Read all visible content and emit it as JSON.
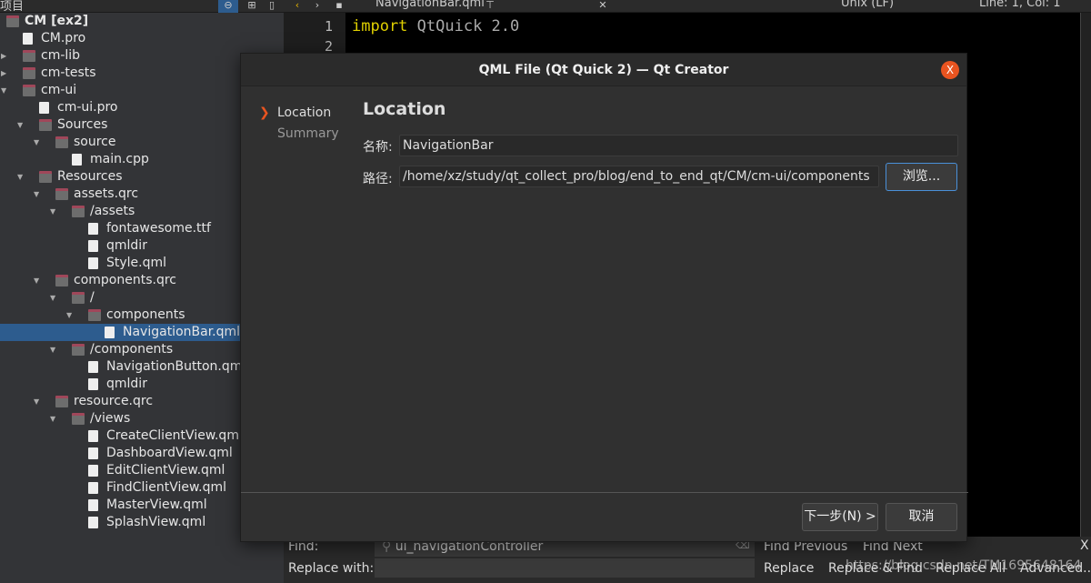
{
  "sidebar": {
    "title": "项目",
    "tree": [
      {
        "label": "CM [ex2]",
        "level": 0,
        "type": "project",
        "bold": true,
        "arrow": "down"
      },
      {
        "label": "CM.pro",
        "level": 1,
        "type": "file"
      },
      {
        "label": "cm-lib",
        "level": 1,
        "type": "project",
        "arrow": "right"
      },
      {
        "label": "cm-tests",
        "level": 1,
        "type": "project",
        "arrow": "right"
      },
      {
        "label": "cm-ui",
        "level": 1,
        "type": "project",
        "arrow": "down"
      },
      {
        "label": "cm-ui.pro",
        "level": 2,
        "type": "file"
      },
      {
        "label": "Sources",
        "level": 2,
        "type": "folder",
        "arrow": "down"
      },
      {
        "label": "source",
        "level": 3,
        "type": "folder",
        "arrow": "down"
      },
      {
        "label": "main.cpp",
        "level": 4,
        "type": "file"
      },
      {
        "label": "Resources",
        "level": 2,
        "type": "folder",
        "arrow": "down"
      },
      {
        "label": "assets.qrc",
        "level": 3,
        "type": "qrc",
        "arrow": "down"
      },
      {
        "label": "/assets",
        "level": 4,
        "type": "folder",
        "arrow": "down"
      },
      {
        "label": "fontawesome.ttf",
        "level": 5,
        "type": "file"
      },
      {
        "label": "qmldir",
        "level": 5,
        "type": "file"
      },
      {
        "label": "Style.qml",
        "level": 5,
        "type": "file"
      },
      {
        "label": "components.qrc",
        "level": 3,
        "type": "qrc",
        "arrow": "down"
      },
      {
        "label": "/",
        "level": 4,
        "type": "folder",
        "arrow": "down"
      },
      {
        "label": "components",
        "level": 5,
        "type": "folder",
        "arrow": "down"
      },
      {
        "label": "NavigationBar.qml",
        "level": 6,
        "type": "file",
        "selected": true
      },
      {
        "label": "/components",
        "level": 4,
        "type": "folder",
        "arrow": "down"
      },
      {
        "label": "NavigationButton.qml",
        "level": 5,
        "type": "file"
      },
      {
        "label": "qmldir",
        "level": 5,
        "type": "file"
      },
      {
        "label": "resource.qrc",
        "level": 3,
        "type": "qrc",
        "arrow": "down"
      },
      {
        "label": "/views",
        "level": 4,
        "type": "folder",
        "arrow": "down"
      },
      {
        "label": "CreateClientView.qml",
        "level": 5,
        "type": "file"
      },
      {
        "label": "DashboardView.qml",
        "level": 5,
        "type": "file"
      },
      {
        "label": "EditClientView.qml",
        "level": 5,
        "type": "file"
      },
      {
        "label": "FindClientView.qml",
        "level": 5,
        "type": "file"
      },
      {
        "label": "MasterView.qml",
        "level": 5,
        "type": "file"
      },
      {
        "label": "SplashView.qml",
        "level": 5,
        "type": "file"
      }
    ]
  },
  "editor": {
    "tab": "NavigationBar.qml",
    "line_ending": "Unix (LF)",
    "position": "Line: 1, Col: 1",
    "lines": [
      "1",
      "2"
    ],
    "code_keyword": "import",
    "code_rest": " QtQuick 2.0"
  },
  "dialog": {
    "title": "QML File (Qt Quick 2) — Qt Creator",
    "close": "X",
    "steps": [
      "Location",
      "Summary"
    ],
    "heading": "Location",
    "name_label": "名称:",
    "name_value": "NavigationBar",
    "path_label": "路径:",
    "path_value": "/home/xz/study/qt_collect_pro/blog/end_to_end_qt/CM/cm-ui/components",
    "browse": "浏览...",
    "next": "下一步(N) >",
    "cancel": "取消"
  },
  "findbar": {
    "find_label": "Find:",
    "find_value": "ui_navigationController",
    "replace_label": "Replace with:",
    "find_previous": "Find Previous",
    "find_next": "Find Next",
    "replace": "Replace",
    "replace_find": "Replace & Find",
    "replace_all": "Replace All",
    "advanced": "Advanced...",
    "close": "X"
  },
  "watermark": "https://blog.csdn.net/TM1695648164",
  "colors": {
    "accent": "#e95420",
    "selection": "#2d5c8e",
    "keyword": "#e0d000"
  }
}
